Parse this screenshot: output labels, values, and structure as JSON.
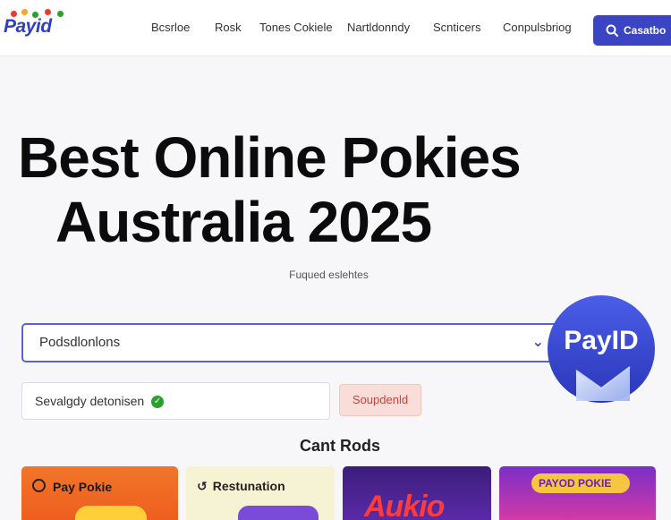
{
  "brand": {
    "logo_text": "Payid"
  },
  "nav": {
    "items": [
      "Bcsrloe",
      "Rosk",
      "Tones Cokiele",
      "Nartldonndy",
      "Scnticers",
      "Conpulsbriog"
    ],
    "search_button": "Casatbo"
  },
  "hero": {
    "title_line1": "Best Online Pokies",
    "title_line2": "Australia 2025",
    "subtitle": "Fuqued eslehtes"
  },
  "form": {
    "main_input_value": "Podsdlonlons",
    "secondary_input_value": "Sevalgdy detonisen",
    "submit_label": "Soupdenld"
  },
  "badge": {
    "text": "PayID"
  },
  "section": {
    "title": "Cant Rods"
  },
  "cards": [
    {
      "label": "Pay Pokie"
    },
    {
      "label": "Restunation"
    },
    {
      "label": "Aukio"
    },
    {
      "label": "PAYOD POKIE"
    }
  ],
  "colors": {
    "accent": "#3b45c4",
    "submit_text": "#c9433a",
    "check": "#2ca02c"
  }
}
